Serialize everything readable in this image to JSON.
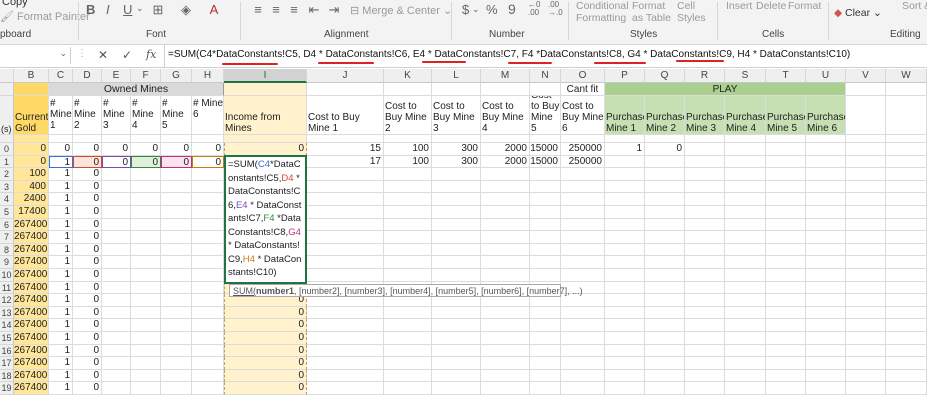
{
  "ribbon": {
    "copy": "Copy",
    "format_painter": "Format Painter",
    "clipboard_label": "pboard",
    "font_label": "Font",
    "bold": "B",
    "italic": "I",
    "underline": "U",
    "alignment_label": "Alignment",
    "merge_center": "Merge & Center",
    "number_label": "Number",
    "dollar": "$",
    "percent": "%",
    "comma": "9",
    "conditional_formatting": "Conditional Formatting",
    "format_as_table": "Format as Table",
    "cell_styles": "Cell Styles",
    "styles_label": "Styles",
    "insert": "Insert",
    "delete": "Delete",
    "format": "Format",
    "cells_label": "Cells",
    "clear": "Clear",
    "sort_filter": "Sort & Filter",
    "editing_label": "Editing"
  },
  "formula_bar": {
    "cancel": "✕",
    "enter": "✓",
    "fx": "fx",
    "formula": "=SUM(C4*DataConstants!C5, D4 * DataConstants!C6, E4 * DataConstants!C7, F4 *DataConstants!C8, G4 * DataConstants!C9, H4 * DataConstants!C10)"
  },
  "columns": [
    "B",
    "C",
    "D",
    "E",
    "F",
    "G",
    "H",
    "I",
    "J",
    "K",
    "L",
    "M",
    "N",
    "O",
    "P",
    "Q",
    "R",
    "S",
    "T",
    "U",
    "V",
    "W"
  ],
  "header_row1": {
    "owned_mines": "Owned Mines",
    "cant_fit": "Cant fit",
    "play": "PLAY"
  },
  "header_row2": {
    "a": "(s)",
    "b": "Current Gold",
    "c": "# Mine 1",
    "d": "# Mine 2",
    "e": "# Mine 3",
    "f": "# Mine 4",
    "g": "# Mine 5",
    "h": "# Mine 6",
    "i": "Income from Mines",
    "j": "Cost to Buy Mine 1",
    "k": "Cost to Buy Mine 2",
    "l": "Cost to Buy Mine 3",
    "m": "Cost to Buy Mine 4",
    "n": "Cost to Buy Mine 5",
    "o": "Cost to Buy Mine 6",
    "p": "Purchase Mine 1",
    "q": "Purchase Mine 2",
    "r": "Purchase Mine 3",
    "s": "Purchase Mine 4",
    "t": "Purchase Mine 5",
    "u": "Purchase Mine 6"
  },
  "rows": [
    {
      "rn": "0",
      "b": "0",
      "c": "0",
      "d": "0",
      "e": "0",
      "f": "0",
      "g": "0",
      "h": "0",
      "i": "0",
      "j": "15",
      "k": "100",
      "l": "300",
      "m": "2000",
      "n": "15000",
      "o": "250000",
      "p": "1",
      "q": "0"
    },
    {
      "rn": "1",
      "b": "0",
      "c": "1",
      "d": "0",
      "e": "0",
      "f": "0",
      "g": "0",
      "h": "0",
      "i": "",
      "j": "17",
      "k": "100",
      "l": "300",
      "m": "2000",
      "n": "15000",
      "o": "250000",
      "p": "",
      "q": ""
    },
    {
      "rn": "2",
      "b": "100",
      "c": "1",
      "d": "0"
    },
    {
      "rn": "3",
      "b": "400",
      "c": "1",
      "d": "0"
    },
    {
      "rn": "4",
      "b": "2400",
      "c": "1",
      "d": "0"
    },
    {
      "rn": "5",
      "b": "17400",
      "c": "1",
      "d": "0"
    },
    {
      "rn": "6",
      "b": "267400",
      "c": "1",
      "d": "0"
    },
    {
      "rn": "7",
      "b": "267400",
      "c": "1",
      "d": "0"
    },
    {
      "rn": "8",
      "b": "267400",
      "c": "1",
      "d": "0"
    },
    {
      "rn": "9",
      "b": "267400",
      "c": "1",
      "d": "0"
    },
    {
      "rn": "10",
      "b": "267400",
      "c": "1",
      "d": "0"
    },
    {
      "rn": "11",
      "b": "267400",
      "c": "1",
      "d": "0",
      "i": "0"
    },
    {
      "rn": "12",
      "b": "267400",
      "c": "1",
      "d": "0",
      "i": "0"
    },
    {
      "rn": "13",
      "b": "267400",
      "c": "1",
      "d": "0",
      "i": "0"
    },
    {
      "rn": "14",
      "b": "267400",
      "c": "1",
      "d": "0",
      "i": "0"
    },
    {
      "rn": "15",
      "b": "267400",
      "c": "1",
      "d": "0",
      "i": "0"
    },
    {
      "rn": "16",
      "b": "267400",
      "c": "1",
      "d": "0",
      "i": "0"
    },
    {
      "rn": "17",
      "b": "267400",
      "c": "1",
      "d": "0",
      "i": "0"
    },
    {
      "rn": "18",
      "b": "267400",
      "c": "1",
      "d": "0",
      "i": "0"
    },
    {
      "rn": "19",
      "b": "267400",
      "c": "1",
      "d": "0",
      "i": "0"
    }
  ],
  "edit_cell": {
    "parts": [
      "=SUM(",
      "C4",
      "*",
      "DataConstants!C5,",
      "D4",
      " * DataConstants!C6,",
      "E4",
      " * DataConstants!C7,",
      "F4",
      " *DataConstants!C8,",
      "G4",
      " * DataConstants!C9,",
      "H4",
      " * DataConstants!C10)"
    ]
  },
  "tooltip": {
    "fn": "SUM(",
    "arg1": "number1",
    "rest": ", [number2], [number3], [number4], [number5], [number6], [number7], ...)"
  },
  "colors": {
    "c4": "#3a6fd8",
    "d4": "#d24a28",
    "e4": "#7b48b8",
    "f4": "#2e8b3e",
    "g4": "#c0307a",
    "h4": "#c77b10"
  }
}
